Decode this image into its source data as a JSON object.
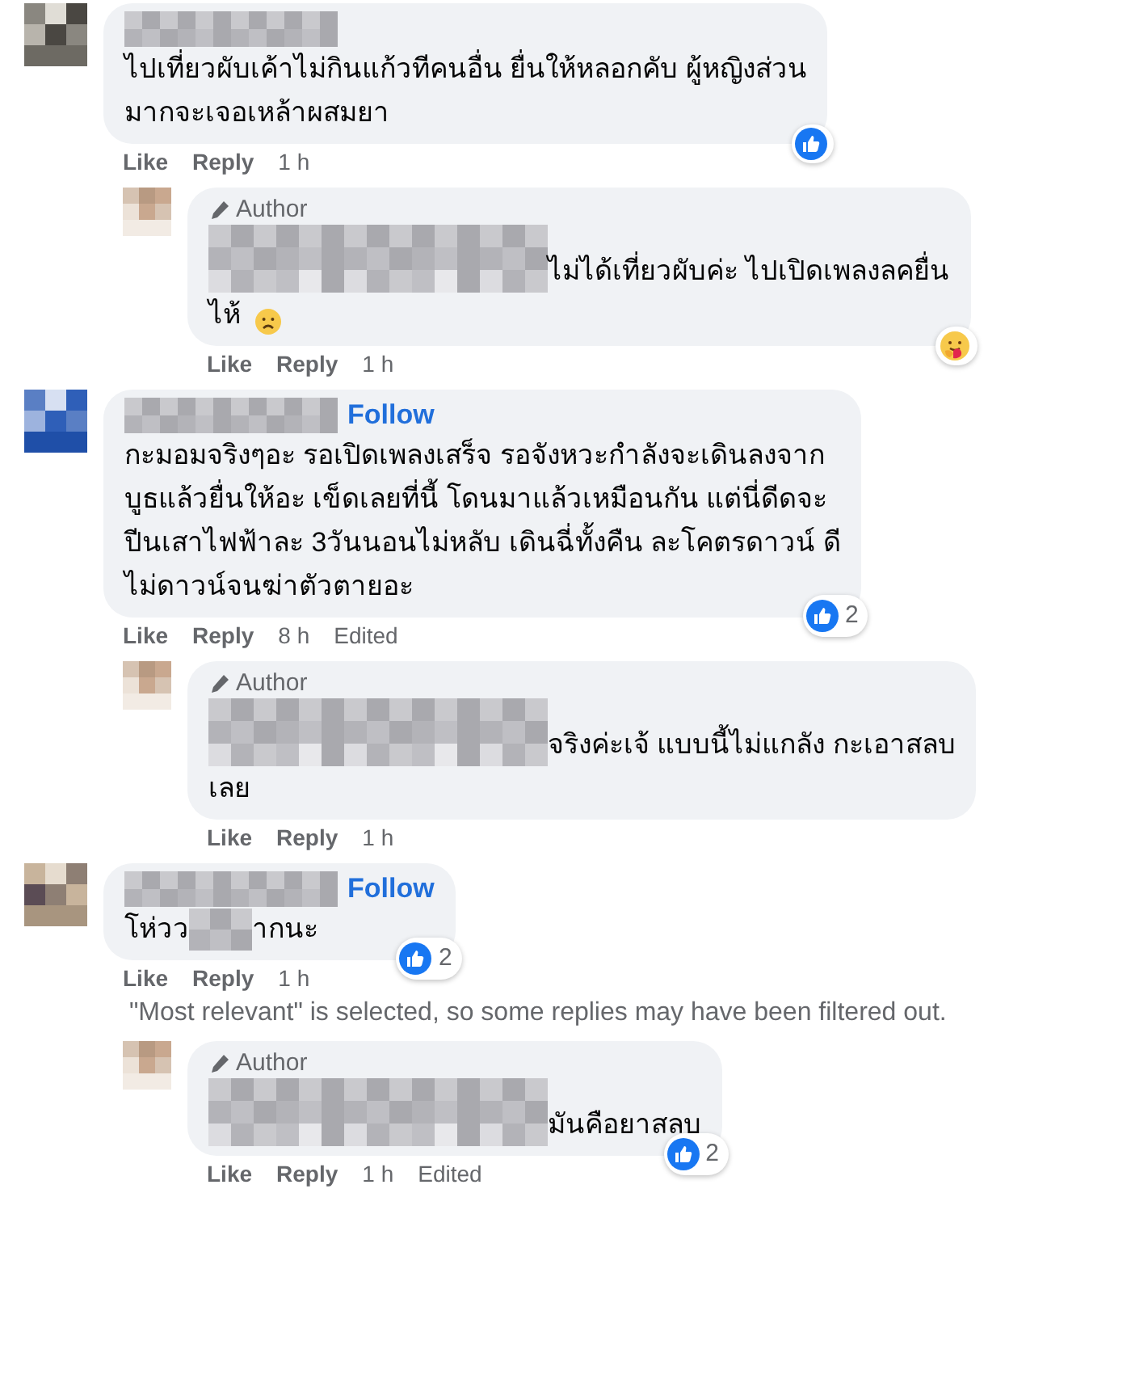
{
  "comments": [
    {
      "kind": "comment",
      "lines": [
        [
          {
            "kind": "text",
            "text": "ไปเที่ยวผับเค้าไม่กินแก้วทีคนอื่น ยื่นให้หลอกคับ ผู้หญิงส่วน"
          }
        ],
        [
          {
            "kind": "text",
            "text": "มากจะเจอเหล้าผสมยา"
          }
        ]
      ],
      "actions": [
        "Like",
        "Reply",
        "1 h"
      ],
      "reaction": {
        "kind": "like"
      }
    },
    {
      "kind": "reply",
      "badge": "Author",
      "lines": [
        [
          {
            "kind": "redacted_name"
          },
          {
            "kind": "text",
            "text": "ไม่ได้เที่ยวผับค่ะ ไปเปิดเพลงลคยื่น"
          }
        ],
        [
          {
            "kind": "text",
            "text": "ไห้"
          },
          {
            "kind": "sad_emoji"
          }
        ]
      ],
      "actions": [
        "Like",
        "Reply",
        "1 h"
      ],
      "reaction": {
        "kind": "care"
      }
    },
    {
      "kind": "comment",
      "follow_label": "Follow",
      "lines": [
        [
          {
            "kind": "text",
            "text": "กะมอมจริงๆอะ รอเปิดเพลงเสร็จ รอจังหวะกำลังจะเดินลงจาก"
          }
        ],
        [
          {
            "kind": "text",
            "text": "บูธแล้วยื่นให้อะ เข็ดเลยที่นี้ โดนมาแล้วเหมือนกัน แต่นี่ดีดจะ"
          }
        ],
        [
          {
            "kind": "text",
            "text": "ปีนเสาไฟฟ้าละ 3วันนอนไม่หลับ เดินฉี่ทั้งคืน ละโคตรดาวน์ ดี"
          }
        ],
        [
          {
            "kind": "text",
            "text": "ไม่ดาวน์จนฆ่าตัวตายอะ"
          }
        ]
      ],
      "actions": [
        "Like",
        "Reply",
        "8 h",
        "Edited"
      ],
      "reaction": {
        "kind": "like",
        "count": "2"
      }
    },
    {
      "kind": "reply",
      "badge": "Author",
      "lines": [
        [
          {
            "kind": "redacted_name"
          },
          {
            "kind": "text",
            "text": "จริงค่ะเจ้ แบบนี้ไม่แกลัง กะเอาสลบ"
          }
        ],
        [
          {
            "kind": "text",
            "text": "เลย"
          }
        ]
      ],
      "actions": [
        "Like",
        "Reply",
        "1 h"
      ]
    },
    {
      "kind": "comment",
      "follow_label": "Follow",
      "lines": [
        [
          {
            "kind": "text",
            "text": "โห่วว"
          },
          {
            "kind": "redacted_word"
          },
          {
            "kind": "text",
            "text": "ากนะ"
          }
        ]
      ],
      "actions": [
        "Like",
        "Reply",
        "1 h"
      ],
      "reaction": {
        "kind": "like",
        "count": "2"
      }
    },
    {
      "kind": "note",
      "text": "\"Most relevant\" is selected, so some replies may have been filtered out."
    },
    {
      "kind": "reply",
      "badge": "Author",
      "lines": [
        [
          {
            "kind": "redacted_name"
          },
          {
            "kind": "text",
            "text": "มันคือยาสลบ"
          }
        ]
      ],
      "actions": [
        "Like",
        "Reply",
        "1 h",
        "Edited"
      ],
      "reaction": {
        "kind": "like",
        "count": "2"
      }
    }
  ]
}
